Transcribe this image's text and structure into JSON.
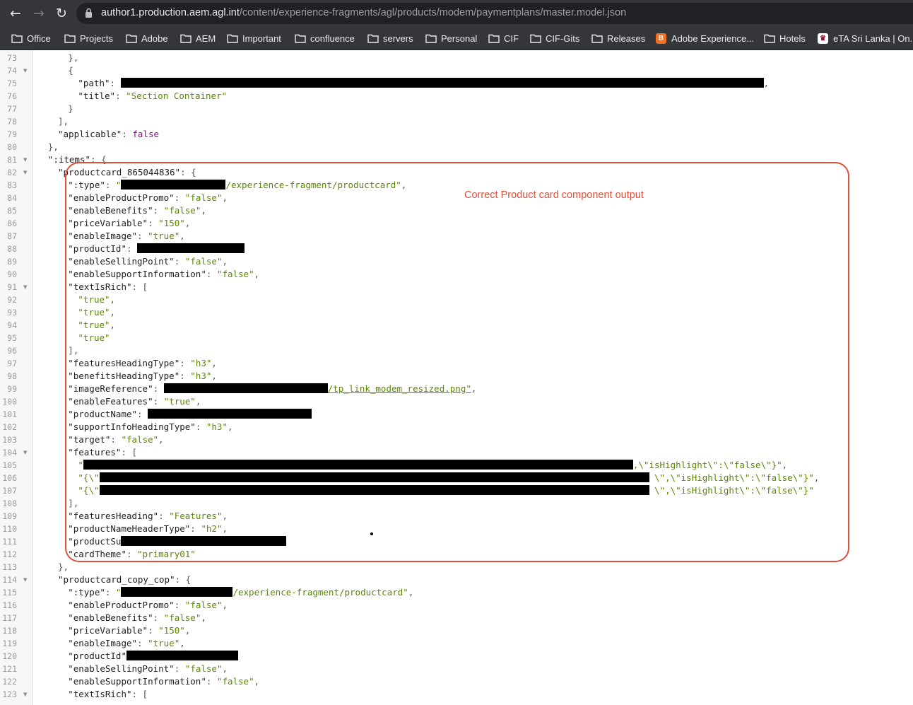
{
  "browser": {
    "url_host": "author1.production.aem.agl.int",
    "url_path": "/content/experience-fragments/agl/products/modem/paymentplans/master.model.json",
    "bookmarks": [
      "Office",
      "Projects",
      "Adobe",
      "AEM",
      "Important",
      "confluence",
      "servers",
      "Personal",
      "CIF",
      "CIF-Gits",
      "Releases",
      "Adobe Experience...",
      "Hotels",
      "eTA Sri Lanka | On..."
    ]
  },
  "annotation": {
    "text": "Correct Product card component output"
  },
  "code": {
    "line_numbers": [
      73,
      74,
      75,
      76,
      77,
      78,
      79,
      80,
      81,
      82,
      83,
      84,
      85,
      86,
      87,
      88,
      89,
      90,
      91,
      92,
      93,
      94,
      95,
      96,
      97,
      98,
      99,
      100,
      101,
      102,
      103,
      104,
      105,
      106,
      107,
      108,
      109,
      110,
      111,
      112,
      113,
      114,
      115,
      116,
      117,
      118,
      119,
      120,
      121,
      122,
      123
    ],
    "lines": [
      {
        "indent": 6,
        "tokens": [
          [
            "p",
            "},"
          ]
        ]
      },
      {
        "indent": 6,
        "tokens": [
          [
            "p",
            "{"
          ]
        ]
      },
      {
        "indent": 7,
        "tokens": [
          [
            "k",
            "\"path\""
          ],
          [
            "p",
            ": "
          ]
        ],
        "redact": 910,
        "after": [
          [
            "p",
            ","
          ]
        ]
      },
      {
        "indent": 7,
        "tokens": [
          [
            "k",
            "\"title\""
          ],
          [
            "p",
            ": "
          ],
          [
            "s",
            "\"Section Container\""
          ]
        ]
      },
      {
        "indent": 6,
        "tokens": [
          [
            "p",
            "}"
          ]
        ]
      },
      {
        "indent": 5,
        "tokens": [
          [
            "p",
            "],"
          ]
        ]
      },
      {
        "indent": 5,
        "tokens": [
          [
            "k",
            "\"applicable\""
          ],
          [
            "p",
            ": "
          ],
          [
            "b",
            "false"
          ]
        ]
      },
      {
        "indent": 4,
        "tokens": [
          [
            "p",
            "},"
          ]
        ]
      },
      {
        "indent": 4,
        "tokens": [
          [
            "k",
            "\":items\""
          ],
          [
            "p",
            ": {"
          ]
        ]
      },
      {
        "indent": 5,
        "tokens": [
          [
            "k",
            "\"productcard_865044836\""
          ],
          [
            "p",
            ": {"
          ]
        ]
      },
      {
        "indent": 6,
        "tokens": [
          [
            "k",
            "\":type\""
          ],
          [
            "p",
            ": "
          ],
          [
            "s",
            "\""
          ]
        ],
        "redact": 148,
        "after": [
          [
            "s",
            "/experience-fragment/productcard\""
          ],
          [
            "p",
            ","
          ]
        ]
      },
      {
        "indent": 6,
        "tokens": [
          [
            "k",
            "\"enableProductPromo\""
          ],
          [
            "p",
            ": "
          ],
          [
            "s",
            "\"false\""
          ],
          [
            "p",
            ","
          ]
        ]
      },
      {
        "indent": 6,
        "tokens": [
          [
            "k",
            "\"enableBenefits\""
          ],
          [
            "p",
            ": "
          ],
          [
            "s",
            "\"false\""
          ],
          [
            "p",
            ","
          ]
        ]
      },
      {
        "indent": 6,
        "tokens": [
          [
            "k",
            "\"priceVariable\""
          ],
          [
            "p",
            ": "
          ],
          [
            "s",
            "\"150\""
          ],
          [
            "p",
            ","
          ]
        ]
      },
      {
        "indent": 6,
        "tokens": [
          [
            "k",
            "\"enableImage\""
          ],
          [
            "p",
            ": "
          ],
          [
            "s",
            "\"true\""
          ],
          [
            "p",
            ","
          ]
        ]
      },
      {
        "indent": 6,
        "tokens": [
          [
            "k",
            "\"productId\""
          ],
          [
            "p",
            ": "
          ]
        ],
        "redact": 152,
        "after": []
      },
      {
        "indent": 6,
        "tokens": [
          [
            "k",
            "\"enableSellingPoint\""
          ],
          [
            "p",
            ": "
          ],
          [
            "s",
            "\"false\""
          ],
          [
            "p",
            ","
          ]
        ]
      },
      {
        "indent": 6,
        "tokens": [
          [
            "k",
            "\"enableSupportInformation\""
          ],
          [
            "p",
            ": "
          ],
          [
            "s",
            "\"false\""
          ],
          [
            "p",
            ","
          ]
        ]
      },
      {
        "indent": 6,
        "tokens": [
          [
            "k",
            "\"textIsRich\""
          ],
          [
            "p",
            ": ["
          ]
        ]
      },
      {
        "indent": 7,
        "tokens": [
          [
            "s",
            "\"true\""
          ],
          [
            "p",
            ","
          ]
        ]
      },
      {
        "indent": 7,
        "tokens": [
          [
            "s",
            "\"true\""
          ],
          [
            "p",
            ","
          ]
        ]
      },
      {
        "indent": 7,
        "tokens": [
          [
            "s",
            "\"true\""
          ],
          [
            "p",
            ","
          ]
        ]
      },
      {
        "indent": 7,
        "tokens": [
          [
            "s",
            "\"true\""
          ]
        ]
      },
      {
        "indent": 6,
        "tokens": [
          [
            "p",
            "],"
          ]
        ]
      },
      {
        "indent": 6,
        "tokens": [
          [
            "k",
            "\"featuresHeadingType\""
          ],
          [
            "p",
            ": "
          ],
          [
            "s",
            "\"h3\""
          ],
          [
            "p",
            ","
          ]
        ]
      },
      {
        "indent": 6,
        "tokens": [
          [
            "k",
            "\"benefitsHeadingType\""
          ],
          [
            "p",
            ": "
          ],
          [
            "s",
            "\"h3\""
          ],
          [
            "p",
            ","
          ]
        ]
      },
      {
        "indent": 6,
        "tokens": [
          [
            "k",
            "\"imageReference\""
          ],
          [
            "p",
            ": "
          ]
        ],
        "redact": 232,
        "after": [
          [
            "u",
            "/tp_link_modem_resized.png\""
          ],
          [
            "p",
            ","
          ]
        ]
      },
      {
        "indent": 6,
        "tokens": [
          [
            "k",
            "\"enableFeatures\""
          ],
          [
            "p",
            ": "
          ],
          [
            "s",
            "\"true\""
          ],
          [
            "p",
            ","
          ]
        ]
      },
      {
        "indent": 6,
        "tokens": [
          [
            "k",
            "\"productName\""
          ],
          [
            "p",
            ": "
          ]
        ],
        "redact": 232,
        "after": []
      },
      {
        "indent": 6,
        "tokens": [
          [
            "k",
            "\"supportInfoHeadingType\""
          ],
          [
            "p",
            ": "
          ],
          [
            "s",
            "\"h3\""
          ],
          [
            "p",
            ","
          ]
        ]
      },
      {
        "indent": 6,
        "tokens": [
          [
            "k",
            "\"target\""
          ],
          [
            "p",
            ": "
          ],
          [
            "s",
            "\"false\""
          ],
          [
            "p",
            ","
          ]
        ]
      },
      {
        "indent": 6,
        "tokens": [
          [
            "k",
            "\"features\""
          ],
          [
            "p",
            ": ["
          ]
        ]
      },
      {
        "indent": 7,
        "tokens": [
          [
            "s",
            "\""
          ]
        ],
        "redact": 778,
        "after": [
          [
            "s",
            ",\\\"isHighlight\\\":\\\"false\\\"}\""
          ],
          [
            "p",
            ","
          ]
        ]
      },
      {
        "indent": 7,
        "tokens": [
          [
            "s",
            "\"{\\\""
          ]
        ],
        "redact": 778,
        "after": [
          [
            "s",
            " \\\",\\\"isHighlight\\\":\\\"false\\\"}\""
          ],
          [
            "p",
            ","
          ]
        ]
      },
      {
        "indent": 7,
        "tokens": [
          [
            "s",
            "\"{\\\""
          ]
        ],
        "redact": 778,
        "after": [
          [
            "s",
            " \\\",\\\"isHighlight\\\":\\\"false\\\"}\""
          ]
        ]
      },
      {
        "indent": 6,
        "tokens": [
          [
            "p",
            "],"
          ]
        ]
      },
      {
        "indent": 6,
        "tokens": [
          [
            "k",
            "\"featuresHeading\""
          ],
          [
            "p",
            ": "
          ],
          [
            "s",
            "\"Features\""
          ],
          [
            "p",
            ","
          ]
        ]
      },
      {
        "indent": 6,
        "tokens": [
          [
            "k",
            "\"productNameHeaderType\""
          ],
          [
            "p",
            ": "
          ],
          [
            "s",
            "\"h2\""
          ],
          [
            "p",
            ","
          ]
        ]
      },
      {
        "indent": 6,
        "tokens": [
          [
            "k",
            "\"productSu"
          ]
        ],
        "redact": 234,
        "after": []
      },
      {
        "indent": 6,
        "tokens": [
          [
            "k",
            "\"cardTheme\""
          ],
          [
            "p",
            ": "
          ],
          [
            "s",
            "\"primary01\""
          ]
        ]
      },
      {
        "indent": 5,
        "tokens": [
          [
            "p",
            "},"
          ]
        ]
      },
      {
        "indent": 5,
        "tokens": [
          [
            "k",
            "\"productcard_copy_cop\""
          ],
          [
            "p",
            ": {"
          ]
        ]
      },
      {
        "indent": 6,
        "tokens": [
          [
            "k",
            "\":type\""
          ],
          [
            "p",
            ": "
          ],
          [
            "s",
            "\""
          ]
        ],
        "redact": 158,
        "after": [
          [
            "s",
            "/experience-fragment/productcard\""
          ],
          [
            "p",
            ","
          ]
        ]
      },
      {
        "indent": 6,
        "tokens": [
          [
            "k",
            "\"enableProductPromo\""
          ],
          [
            "p",
            ": "
          ],
          [
            "s",
            "\"false\""
          ],
          [
            "p",
            ","
          ]
        ]
      },
      {
        "indent": 6,
        "tokens": [
          [
            "k",
            "\"enableBenefits\""
          ],
          [
            "p",
            ": "
          ],
          [
            "s",
            "\"false\""
          ],
          [
            "p",
            ","
          ]
        ]
      },
      {
        "indent": 6,
        "tokens": [
          [
            "k",
            "\"priceVariable\""
          ],
          [
            "p",
            ": "
          ],
          [
            "s",
            "\"150\""
          ],
          [
            "p",
            ","
          ]
        ]
      },
      {
        "indent": 6,
        "tokens": [
          [
            "k",
            "\"enableImage\""
          ],
          [
            "p",
            ": "
          ],
          [
            "s",
            "\"true\""
          ],
          [
            "p",
            ","
          ]
        ]
      },
      {
        "indent": 6,
        "tokens": [
          [
            "k",
            "\"productId\""
          ]
        ],
        "redact": 158,
        "after": []
      },
      {
        "indent": 6,
        "tokens": [
          [
            "k",
            "\"enableSellingPoint\""
          ],
          [
            "p",
            ": "
          ],
          [
            "s",
            "\"false\""
          ],
          [
            "p",
            ","
          ]
        ]
      },
      {
        "indent": 6,
        "tokens": [
          [
            "k",
            "\"enableSupportInformation\""
          ],
          [
            "p",
            ": "
          ],
          [
            "s",
            "\"false\""
          ],
          [
            "p",
            ","
          ]
        ]
      },
      {
        "indent": 6,
        "tokens": [
          [
            "k",
            "\"textIsRich\""
          ],
          [
            "p",
            ": ["
          ]
        ]
      }
    ],
    "folded_lines": [
      74,
      81,
      82,
      91,
      104,
      114,
      123
    ]
  }
}
